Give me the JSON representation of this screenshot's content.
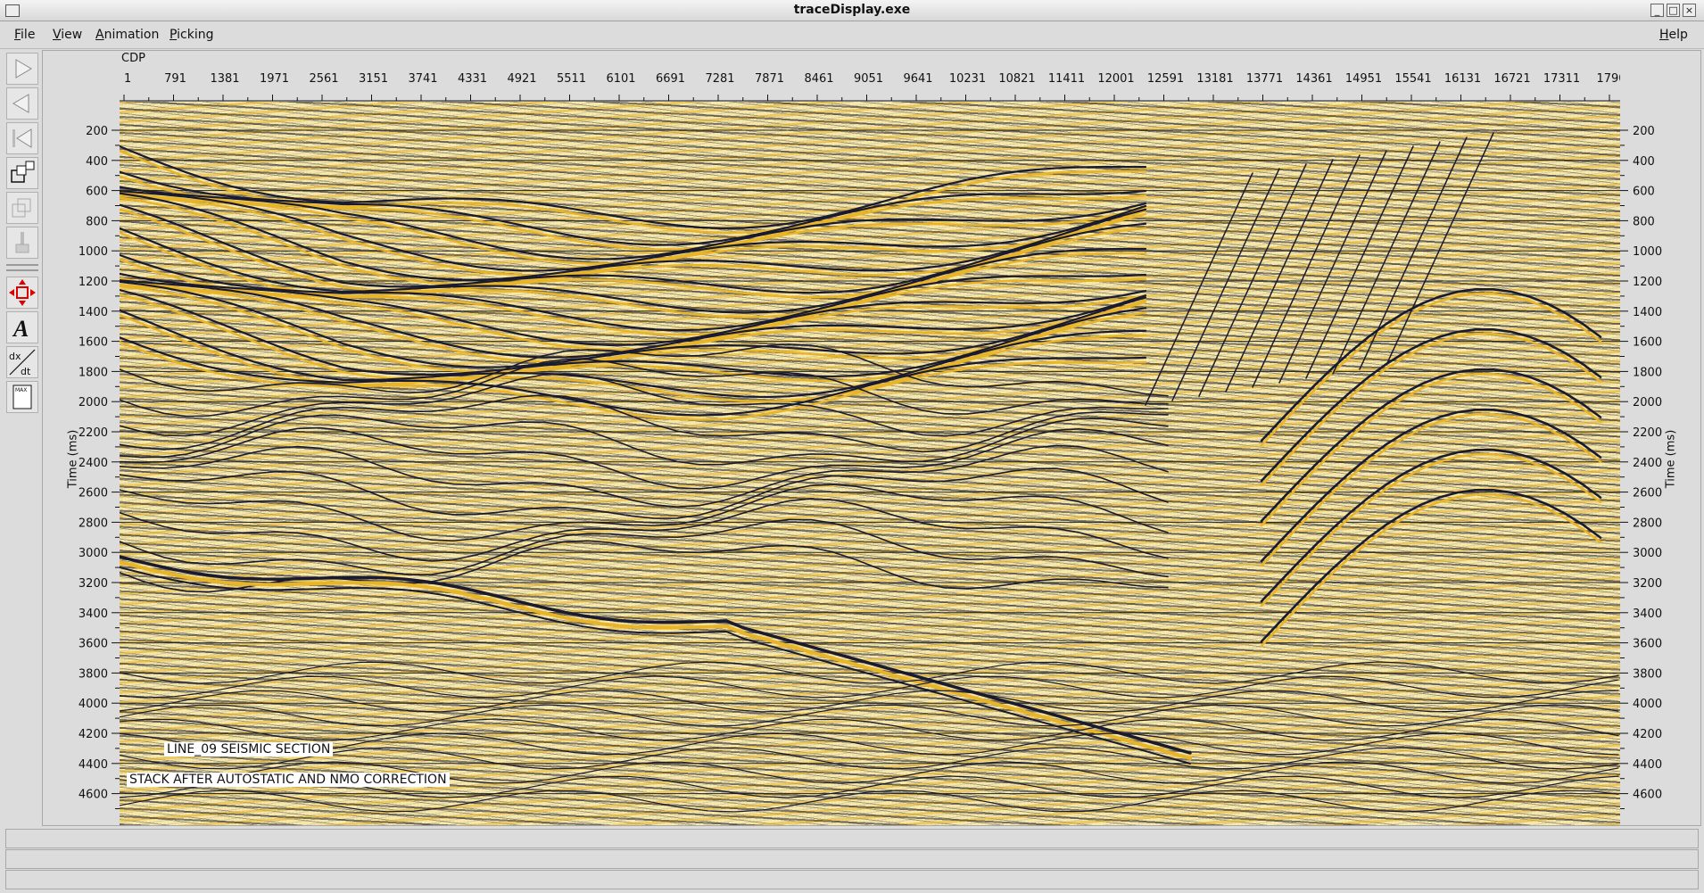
{
  "window": {
    "title": "traceDisplay.exe",
    "buttons": {
      "minimize": "_",
      "maximize": "□",
      "close": "×"
    }
  },
  "menu": {
    "items": [
      {
        "id": "file",
        "u": "F",
        "rest": "ile",
        "x": 16
      },
      {
        "id": "view",
        "u": "V",
        "rest": "iew",
        "x": 59
      },
      {
        "id": "animation",
        "u": "A",
        "rest": "nimation",
        "x": 107
      },
      {
        "id": "picking",
        "u": "P",
        "rest": "icking",
        "x": 190
      }
    ],
    "help": {
      "u": "H",
      "rest": "elp"
    }
  },
  "toolbar": {
    "icons": [
      "play-forward-icon",
      "play-backward-icon",
      "step-back-icon",
      "zoom-windows-icon",
      "copy-windows-icon",
      "paint-brush-icon",
      "pan-move-icon",
      "text-annotation-icon",
      "derivative-dxdt-icon",
      "max-amplitude-icon"
    ]
  },
  "plot": {
    "xaxis_title": "CDP",
    "x_ticks": [
      "1",
      "791",
      "1381",
      "1971",
      "2561",
      "3151",
      "3741",
      "4331",
      "4921",
      "5511",
      "6101",
      "6691",
      "7281",
      "7871",
      "8461",
      "9051",
      "9641",
      "10231",
      "10821",
      "11411",
      "12001",
      "12591",
      "13181",
      "13771",
      "14361",
      "14951",
      "15541",
      "16131",
      "16721",
      "17311",
      "1790"
    ],
    "y_ticks": [
      "200",
      "400",
      "600",
      "800",
      "1000",
      "1200",
      "1400",
      "1600",
      "1800",
      "2000",
      "2200",
      "2400",
      "2600",
      "2800",
      "3000",
      "3200",
      "3400",
      "3600",
      "3800",
      "4000",
      "4200",
      "4400",
      "4600"
    ],
    "ylabel_left": "Time (ms)",
    "ylabel_right": "Time (ms)",
    "annotations": [
      "LINE_09 SEISMIC SECTION",
      "STACK AFTER AUTOSTATIC AND NMO CORRECTION"
    ],
    "colors": {
      "peak": "#1a1a2e",
      "trough": "#e8b428",
      "background": "#f6e6a4"
    }
  },
  "status": {
    "line1": "",
    "line2": "",
    "line3": ""
  }
}
